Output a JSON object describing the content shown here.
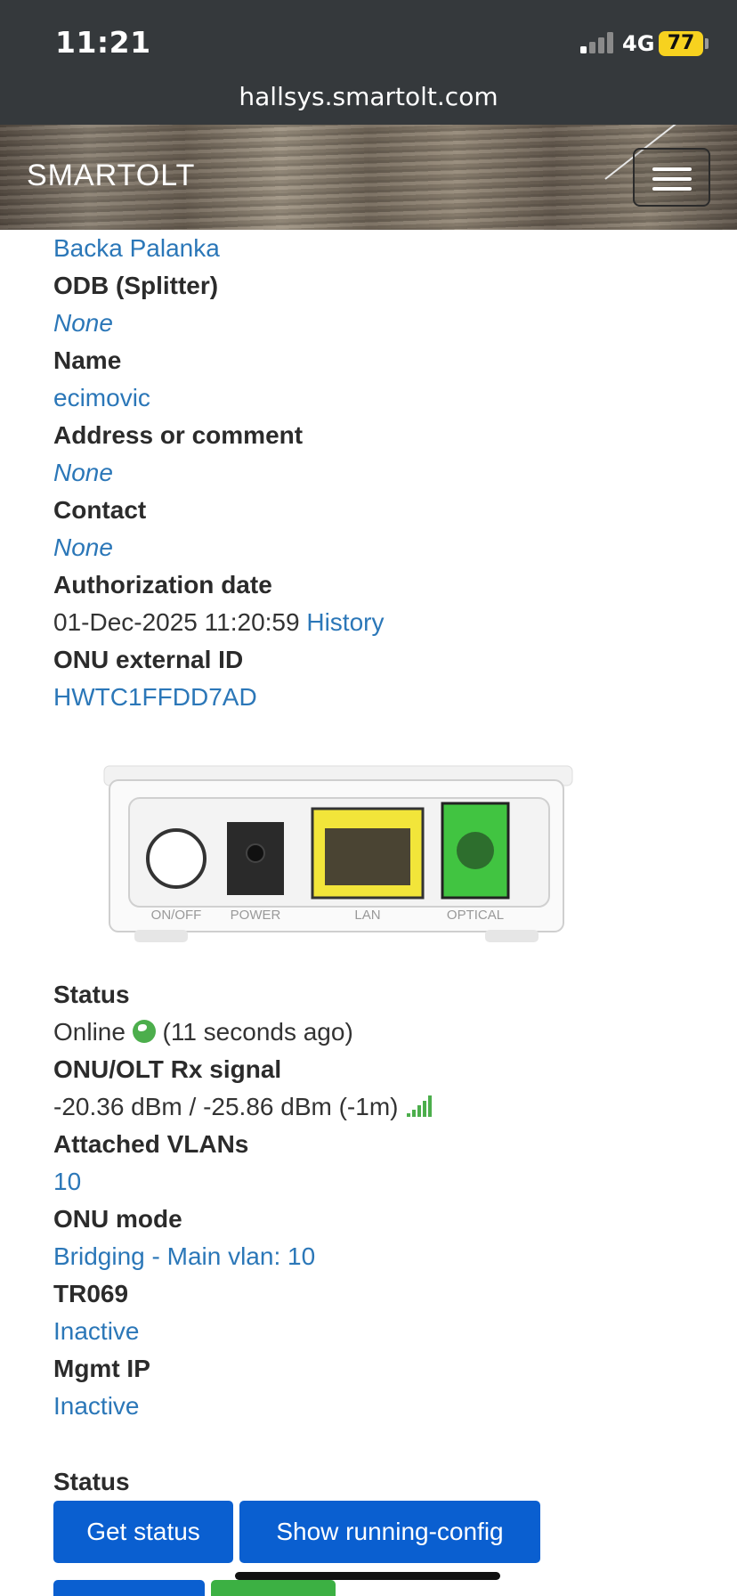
{
  "status_bar": {
    "time": "11:21",
    "network": "4G",
    "battery": "77"
  },
  "browser": {
    "url": "hallsys.smartolt.com"
  },
  "navbar": {
    "brand": "SMARTOLT"
  },
  "fields": {
    "zone_value": "Backa Palanka",
    "odb_label": "ODB (Splitter)",
    "odb_value": "None",
    "name_label": "Name",
    "name_value": "ecimovic",
    "address_label": "Address or comment",
    "address_value": "None",
    "contact_label": "Contact",
    "contact_value": "None",
    "auth_label": "Authorization date",
    "auth_value": "01-Dec-2025 11:20:59",
    "auth_history": "History",
    "extid_label": "ONU external ID",
    "extid_value": "HWTC1FFDD7AD"
  },
  "device": {
    "port_labels": [
      "ON/OFF",
      "POWER",
      "LAN",
      "OPTICAL"
    ]
  },
  "status": {
    "status_label": "Status",
    "status_value": "Online",
    "status_ago": "(11 seconds ago)",
    "signal_label": "ONU/OLT Rx signal",
    "signal_value": "-20.36 dBm / -25.86 dBm (-1m)",
    "vlans_label": "Attached VLANs",
    "vlans_value": "10",
    "mode_label": "ONU mode",
    "mode_value": "Bridging - Main vlan: 10",
    "tr069_label": "TR069",
    "tr069_value": "Inactive",
    "mgmt_label": "Mgmt IP",
    "mgmt_value": "Inactive"
  },
  "actions": {
    "section_label": "Status",
    "get_status": "Get status",
    "show_config": "Show running-config"
  },
  "colors": {
    "link": "#2b77b8",
    "button": "#0a5fd0",
    "online": "#4cae4c"
  }
}
